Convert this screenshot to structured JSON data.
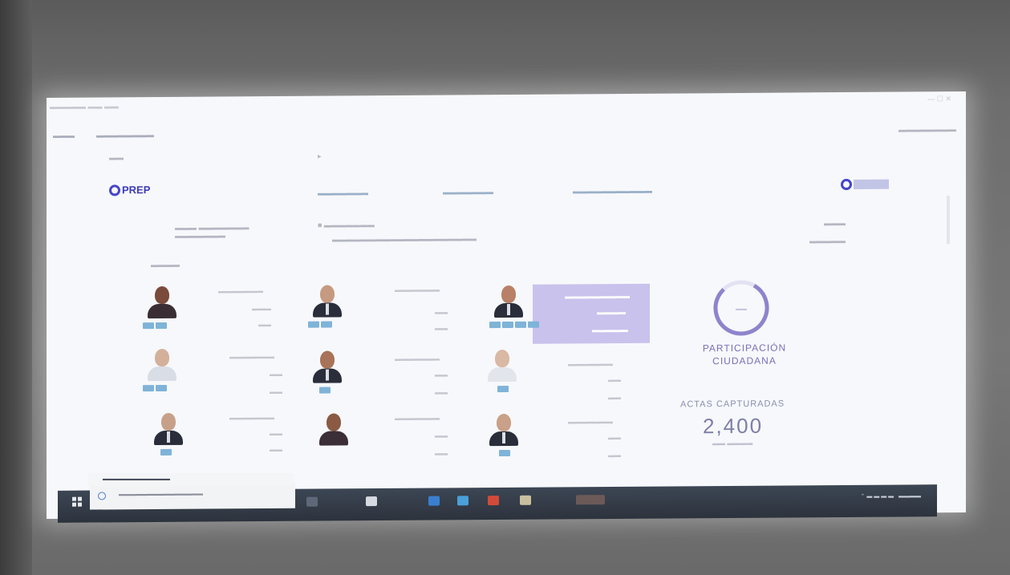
{
  "app": {
    "logo_text": "PREP"
  },
  "participation": {
    "label_line1": "PARTICIPACIÓN",
    "label_line2": "CIUDADANA"
  },
  "actas": {
    "label": "ACTAS CAPTURADAS",
    "value": "2,400"
  },
  "colors": {
    "accent": "#7a70b8",
    "highlight": "#c9c2ec",
    "badge": "#7fb3d8",
    "taskbar": "#2d333d"
  },
  "candidates": [
    {
      "id": "c1",
      "row": 1,
      "col": 1,
      "avatar": "woman-portrait",
      "badges": 2
    },
    {
      "id": "c2",
      "row": 1,
      "col": 2,
      "avatar": "man-portrait",
      "badges": 2
    },
    {
      "id": "c3",
      "row": 1,
      "col": 3,
      "avatar": "man-portrait",
      "badges": 4,
      "highlighted": true
    },
    {
      "id": "c4",
      "row": 2,
      "col": 1,
      "avatar": "man-portrait",
      "badges": 2
    },
    {
      "id": "c5",
      "row": 2,
      "col": 2,
      "avatar": "man-portrait",
      "badges": 1
    },
    {
      "id": "c6",
      "row": 2,
      "col": 3,
      "avatar": "man-portrait",
      "badges": 1
    },
    {
      "id": "c7",
      "row": 3,
      "col": 1,
      "avatar": "man-portrait",
      "badges": 1
    },
    {
      "id": "c8",
      "row": 3,
      "col": 2,
      "avatar": "woman-portrait",
      "badges": 0
    },
    {
      "id": "c9",
      "row": 3,
      "col": 3,
      "avatar": "man-portrait",
      "badges": 1
    }
  ],
  "icons": [
    "windows-start-icon",
    "search-icon",
    "task-view-icon",
    "file-explorer-icon",
    "edge-icon",
    "store-icon",
    "powerpoint-icon",
    "chrome-icon"
  ]
}
